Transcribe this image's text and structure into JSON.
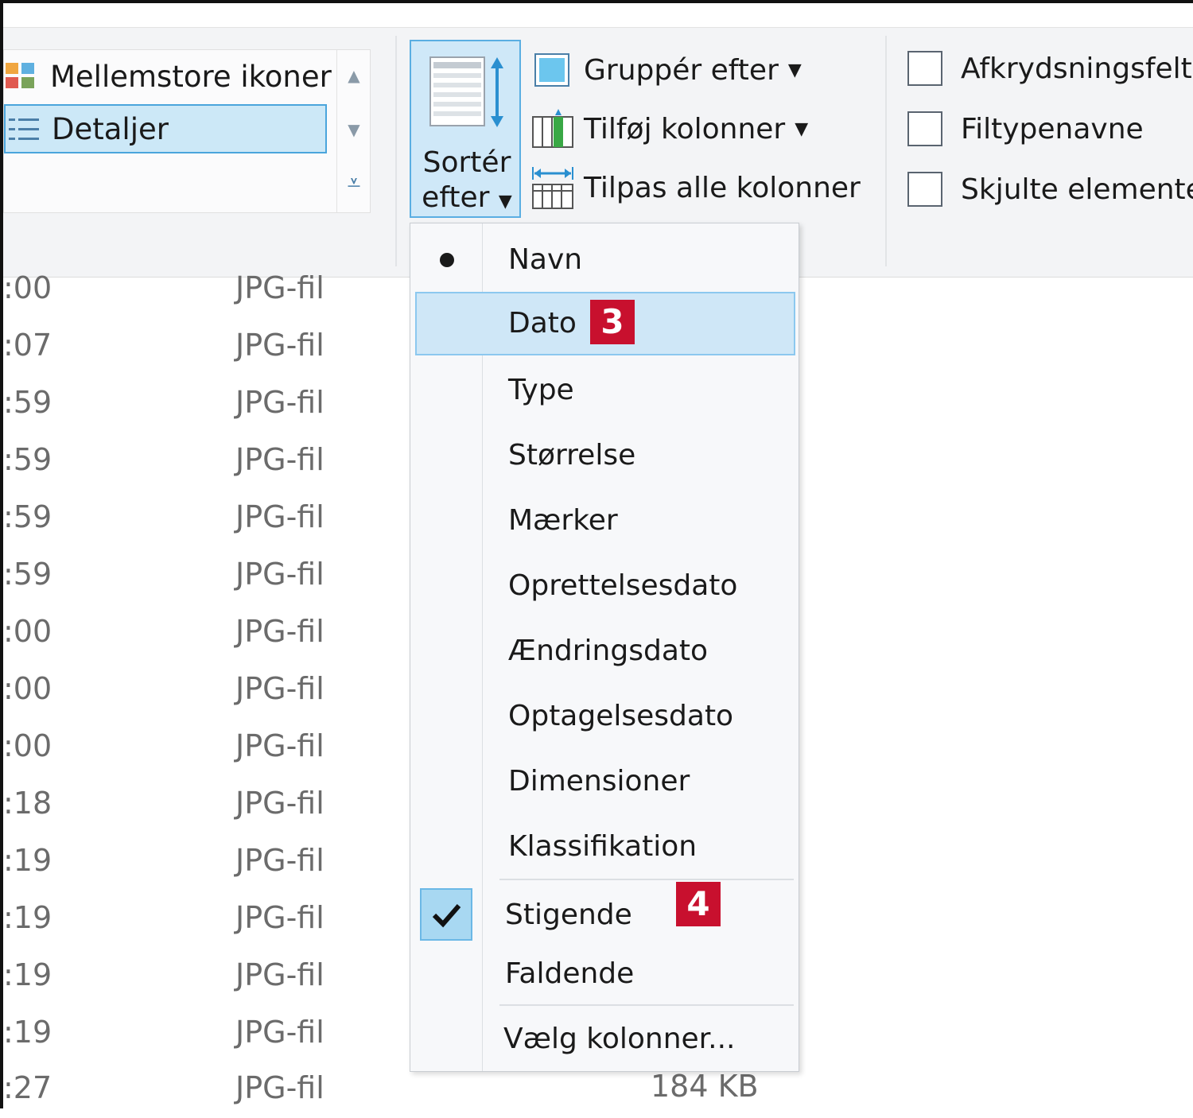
{
  "ribbon": {
    "layout": {
      "items": [
        {
          "label": "Mellemstore ikoner",
          "icon": "medium-icons-icon"
        },
        {
          "label": "Detaljer",
          "icon": "details-icon",
          "selected": true
        }
      ]
    },
    "sort": {
      "line1": "Sortér",
      "line2": "efter"
    },
    "commands": [
      {
        "label": "Gruppér efter",
        "icon": "group-by-icon",
        "has_dropdown": true
      },
      {
        "label": "Tilføj kolonner",
        "icon": "add-columns-icon",
        "has_dropdown": true
      },
      {
        "label": "Tilpas alle kolonner",
        "icon": "fit-columns-icon",
        "has_dropdown": false
      }
    ],
    "show_hide": [
      {
        "label": "Afkrydsningsfelt",
        "checked": false
      },
      {
        "label": "Filtypenavne",
        "checked": false
      },
      {
        "label": "Skjulte elemente",
        "checked": false
      }
    ]
  },
  "files": [
    {
      "time": ":00",
      "type": "JPG-fil"
    },
    {
      "time": ":07",
      "type": "JPG-fil"
    },
    {
      "time": ":59",
      "type": "JPG-fil"
    },
    {
      "time": ":59",
      "type": "JPG-fil"
    },
    {
      "time": ":59",
      "type": "JPG-fil"
    },
    {
      "time": ":59",
      "type": "JPG-fil"
    },
    {
      "time": ":00",
      "type": "JPG-fil"
    },
    {
      "time": ":00",
      "type": "JPG-fil"
    },
    {
      "time": ":00",
      "type": "JPG-fil"
    },
    {
      "time": ":18",
      "type": "JPG-fil"
    },
    {
      "time": ":19",
      "type": "JPG-fil"
    },
    {
      "time": ":19",
      "type": "JPG-fil"
    },
    {
      "time": ":19",
      "type": "JPG-fil"
    },
    {
      "time": ":19",
      "type": "JPG-fil"
    },
    {
      "time": ":27",
      "type": "JPG-fil",
      "size": "184 KB"
    }
  ],
  "sort_menu": {
    "columns": [
      {
        "label": "Navn",
        "selected": true
      },
      {
        "label": "Dato",
        "highlighted": true,
        "badge": "3"
      },
      {
        "label": "Type"
      },
      {
        "label": "Størrelse"
      },
      {
        "label": "Mærker"
      },
      {
        "label": "Oprettelsesdato"
      },
      {
        "label": "Ændringsdato"
      },
      {
        "label": "Optagelsesdato"
      },
      {
        "label": "Dimensioner"
      },
      {
        "label": "Klassifikation"
      }
    ],
    "order": [
      {
        "label": "Stigende",
        "checked": true,
        "badge": "4"
      },
      {
        "label": "Faldende"
      }
    ],
    "choose_columns": "Vælg kolonner..."
  },
  "colors": {
    "accent": "#cce8f7",
    "accent_border": "#4aa5dc",
    "badge": "#c8102e"
  }
}
